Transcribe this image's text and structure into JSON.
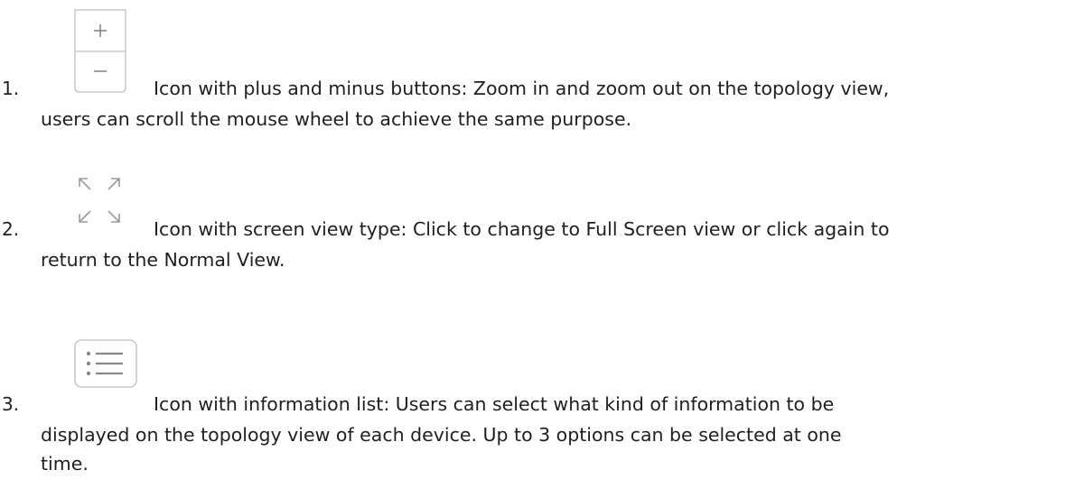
{
  "items": [
    {
      "number": "1.",
      "icon": "zoom-plus-minus-icon",
      "line1": "Icon with plus and minus buttons: Zoom in and zoom out on the topology view,",
      "line2": "users can scroll the mouse wheel to achieve the same purpose."
    },
    {
      "number": "2.",
      "icon": "fullscreen-arrows-icon",
      "line1": "Icon with screen view type: Click to change to Full Screen view or click again to",
      "line2": "return to the Normal View."
    },
    {
      "number": "3.",
      "icon": "information-list-icon",
      "line1": "Icon with information list: Users can select what kind of information to be",
      "line2": "displayed on the topology view of each device. Up to 3 options can be selected at one",
      "line3": "time."
    }
  ],
  "colors": {
    "text": "#1f1f1f",
    "icon": "#9a9a9a",
    "icon_border": "#c8c8c8"
  }
}
